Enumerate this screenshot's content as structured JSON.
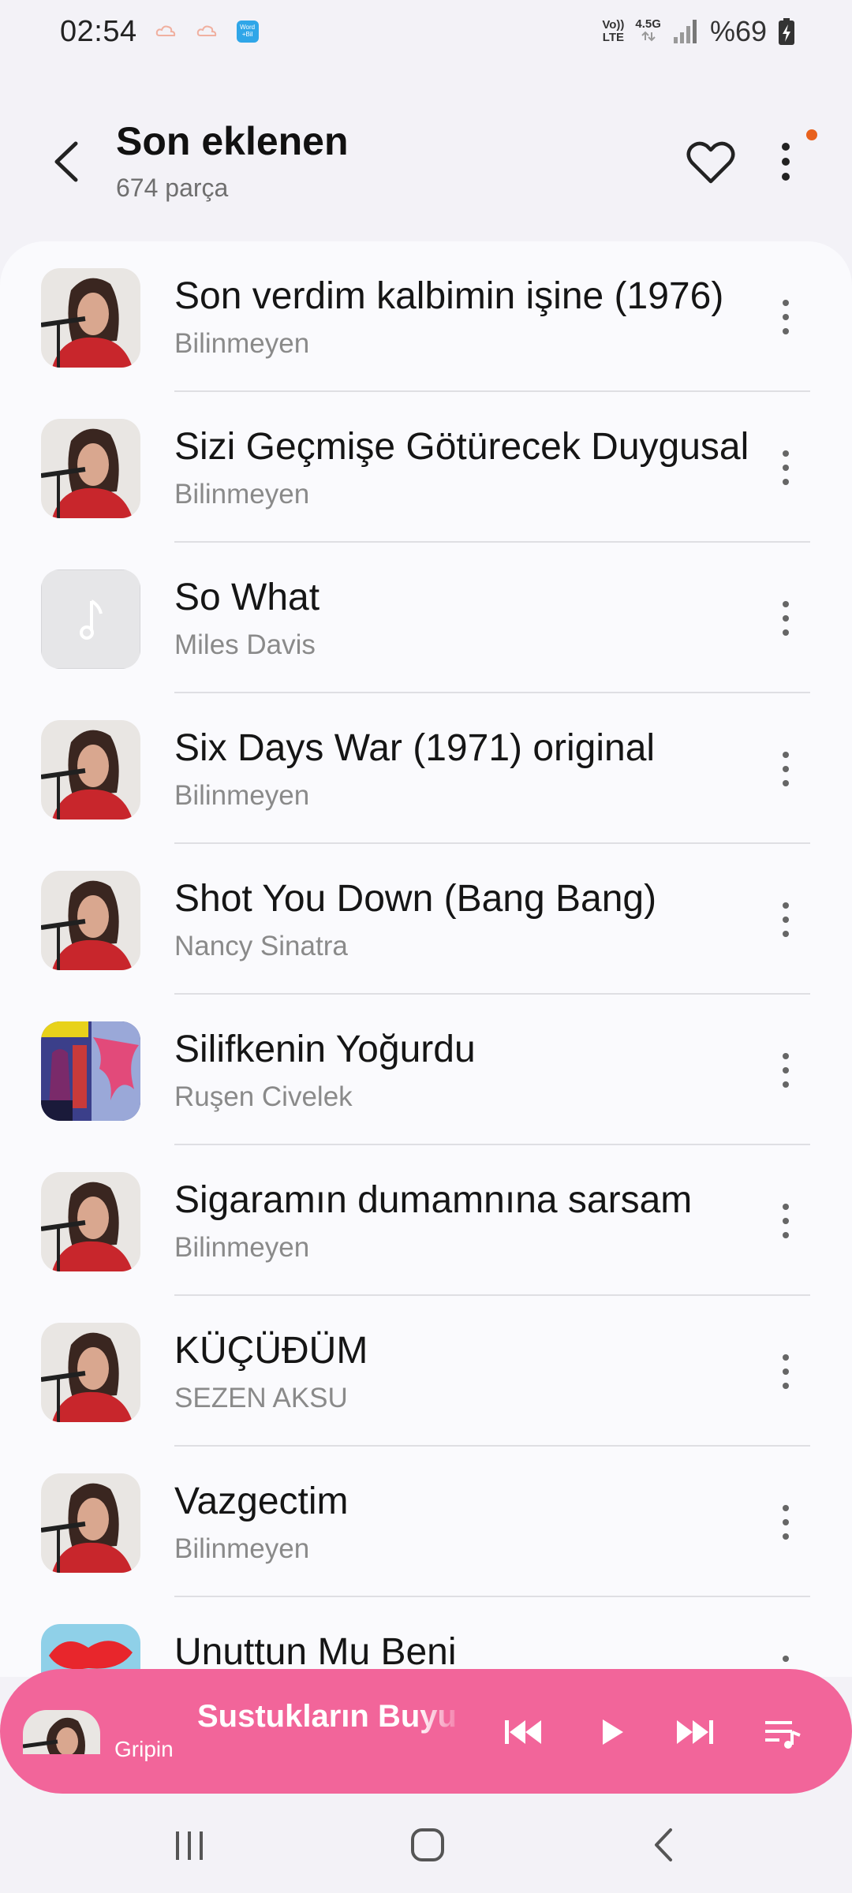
{
  "status_bar": {
    "time": "02:54",
    "volte_line1": "Vo))",
    "volte_line2": "LTE",
    "network_type": "4.5G",
    "battery": "%69",
    "notif_app_label_1": "Word",
    "notif_app_label_2": "+Bil"
  },
  "header": {
    "title": "Son eklenen",
    "subtitle": "674 parça",
    "back_icon": "chevron-left-icon",
    "favorite_icon": "heart-icon",
    "more_icon": "vertical-dots-icon"
  },
  "tracks": [
    {
      "title": "Son verdim kalbimin işine (1976)",
      "artist": "Bilinmeyen",
      "art": "portrait"
    },
    {
      "title": "Sizi Geçmişe Götürecek Duygusal",
      "artist": "Bilinmeyen",
      "art": "portrait"
    },
    {
      "title": "So What",
      "artist": "Miles Davis",
      "art": "placeholder"
    },
    {
      "title": "Six Days War (1971) original",
      "artist": "Bilinmeyen",
      "art": "portrait"
    },
    {
      "title": "Shot You Down (Bang Bang)",
      "artist": "Nancy Sinatra",
      "art": "portrait"
    },
    {
      "title": "Silifkenin Yoğurdu",
      "artist": "Ruşen Civelek",
      "art": "album-cover"
    },
    {
      "title": "Sigaramın dumamnına sarsam",
      "artist": "Bilinmeyen",
      "art": "portrait"
    },
    {
      "title": "KÜÇÜĐÜM",
      "artist": "SEZEN AKSU",
      "art": "portrait"
    },
    {
      "title": "Vazgectim",
      "artist": "Bilinmeyen",
      "art": "portrait"
    },
    {
      "title": "Unuttun Mu Beni",
      "artist": "",
      "art": "sezen-cover"
    }
  ],
  "mini_player": {
    "title": "Sustukların Buyumuş",
    "artist": "Gripin",
    "controls": [
      "previous-icon",
      "play-icon",
      "next-icon",
      "queue-icon"
    ]
  },
  "nav": [
    "recents-icon",
    "home-icon",
    "back-icon"
  ],
  "colors": {
    "accent": "#f2659a",
    "notification_dot": "#e8611d",
    "background": "#f3f2f7",
    "list_background": "#fafafd"
  }
}
